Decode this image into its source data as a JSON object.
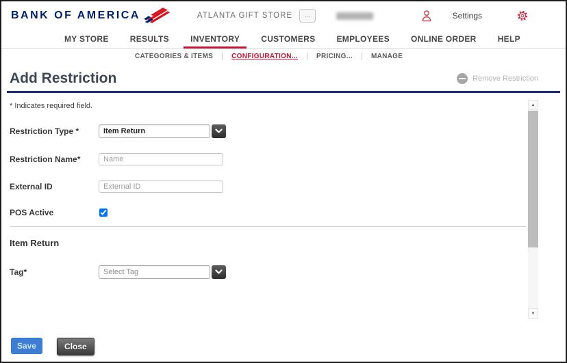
{
  "header": {
    "brand": "BANK OF AMERICA",
    "store_name": "ATLANTA GIFT STORE",
    "store_switcher_label": "...",
    "settings_label": "Settings"
  },
  "nav": {
    "items": [
      {
        "label": "MY STORE",
        "active": false
      },
      {
        "label": "RESULTS",
        "active": false
      },
      {
        "label": "INVENTORY",
        "active": true
      },
      {
        "label": "CUSTOMERS",
        "active": false
      },
      {
        "label": "EMPLOYEES",
        "active": false
      },
      {
        "label": "ONLINE ORDER",
        "active": false
      },
      {
        "label": "HELP",
        "active": false
      }
    ]
  },
  "subnav": {
    "items": [
      {
        "label": "CATEGORIES & ITEMS",
        "active": false
      },
      {
        "label": "CONFIGURATION...",
        "active": true
      },
      {
        "label": "PRICING...",
        "active": false
      },
      {
        "label": "MANAGE",
        "active": false
      }
    ]
  },
  "page": {
    "title": "Add Restriction",
    "remove_action_label": "Remove Restriction",
    "required_note": "* Indicates required field."
  },
  "form": {
    "restriction_type": {
      "label": "Restriction Type *",
      "value": "Item Return"
    },
    "restriction_name": {
      "label": "Restriction Name*",
      "placeholder": "Name",
      "value": ""
    },
    "external_id": {
      "label": "External ID",
      "placeholder": "External ID",
      "value": ""
    },
    "pos_active": {
      "label": "POS Active",
      "checked": true
    },
    "section_title": "Item Return",
    "tag": {
      "label": "Tag*",
      "placeholder": "Select Tag"
    }
  },
  "footer": {
    "save_label": "Save",
    "close_label": "Close"
  },
  "colors": {
    "brand_navy": "#012169",
    "brand_red": "#c41230",
    "icon_red": "#cf3149",
    "title_rule_navy": "#1b2f77",
    "save_blue": "#3d7ed2"
  }
}
